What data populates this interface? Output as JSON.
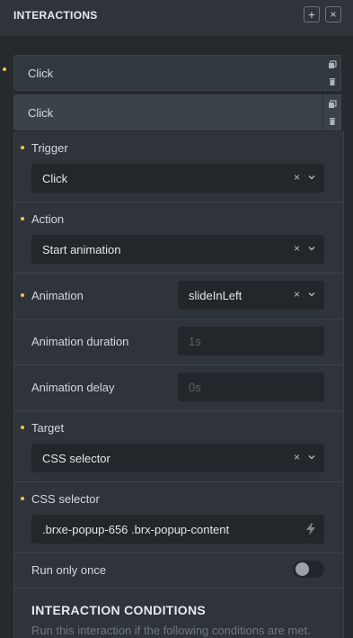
{
  "panel": {
    "title": "INTERACTIONS",
    "add_label": "+",
    "close_label": "×"
  },
  "interactions": [
    {
      "label": "Click"
    },
    {
      "label": "Click"
    }
  ],
  "form": {
    "trigger": {
      "label": "Trigger",
      "value": "Click",
      "clear": "×"
    },
    "action": {
      "label": "Action",
      "value": "Start animation",
      "clear": "×"
    },
    "animation": {
      "label": "Animation",
      "value": "slideInLeft",
      "clear": "×"
    },
    "animation_duration": {
      "label": "Animation duration",
      "placeholder": "1s"
    },
    "animation_delay": {
      "label": "Animation delay",
      "placeholder": "0s"
    },
    "target": {
      "label": "Target",
      "value": "CSS selector",
      "clear": "×"
    },
    "css_selector": {
      "label": "CSS selector",
      "value": ".brxe-popup-656 .brx-popup-content"
    },
    "run_only_once": {
      "label": "Run only once",
      "enabled": false
    }
  },
  "conditions": {
    "title": "INTERACTION CONDITIONS",
    "description": "Run this interaction if the following conditions are met."
  },
  "colors": {
    "accent_dot": "#f4c542",
    "panel_bg": "#2b3036",
    "field_bg": "#23272c"
  },
  "icons": [
    "plus-icon",
    "close-icon",
    "copy-icon",
    "trash-icon",
    "clear-icon",
    "chevron-down-icon",
    "bolt-icon"
  ]
}
